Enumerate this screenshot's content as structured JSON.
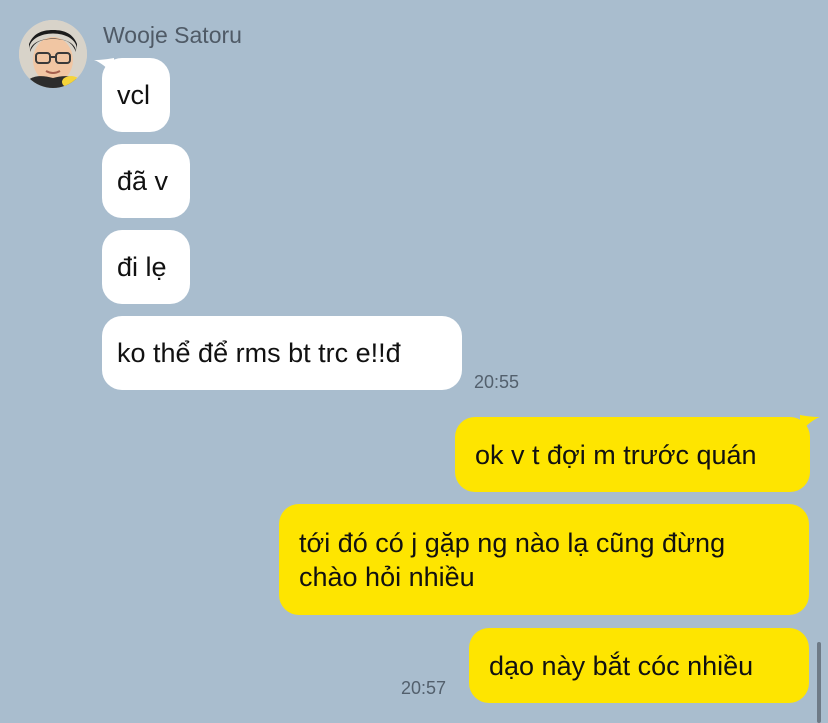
{
  "chat": {
    "sender_name": "Wooje Satoru",
    "incoming": [
      {
        "text": "vcl"
      },
      {
        "text": "đã v"
      },
      {
        "text": "đi lẹ"
      },
      {
        "text": "ko thể để rms bt trc e!!đ"
      }
    ],
    "incoming_time": "20:55",
    "outgoing": [
      {
        "text": "ok v t đợi m trước quán"
      },
      {
        "lines": [
          "tới đó có j gặp ng nào lạ cũng đừng",
          "chào hỏi nhiều"
        ]
      },
      {
        "text": "dạo này bắt cóc nhiều"
      }
    ],
    "outgoing_time": "20:57"
  },
  "colors": {
    "background": "#a9bdce",
    "incoming_bubble": "#ffffff",
    "outgoing_bubble": "#fee500"
  }
}
